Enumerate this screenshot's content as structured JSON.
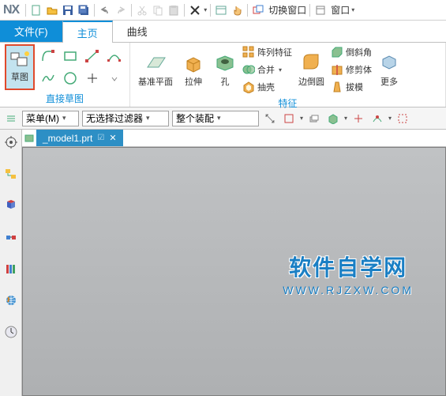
{
  "app": {
    "logo": "NX"
  },
  "titlebar": {
    "switch_window": "切换窗口",
    "window": "窗口"
  },
  "tabs": {
    "file": "文件(F)",
    "home": "主页",
    "curve": "曲线"
  },
  "ribbon": {
    "sketch": {
      "label": "草图"
    },
    "direct_sketch_group": "直接草图",
    "datum_plane": "基准平面",
    "extrude": "拉伸",
    "hole": "孔",
    "pattern": "阵列特征",
    "unite": "合并",
    "shell": "抽壳",
    "edge_blend": "边倒圆",
    "chamfer": "倒斜角",
    "trim_body": "修剪体",
    "draft": "拔模",
    "more": "更多",
    "feature_group": "特征"
  },
  "selbar": {
    "menu": "菜单(M)",
    "filter": "无选择过滤器",
    "assembly": "整个装配"
  },
  "doc": {
    "name": "_model1.prt"
  },
  "watermark": {
    "main": "软件自学网",
    "sub": "WWW.RJZXW.COM"
  }
}
